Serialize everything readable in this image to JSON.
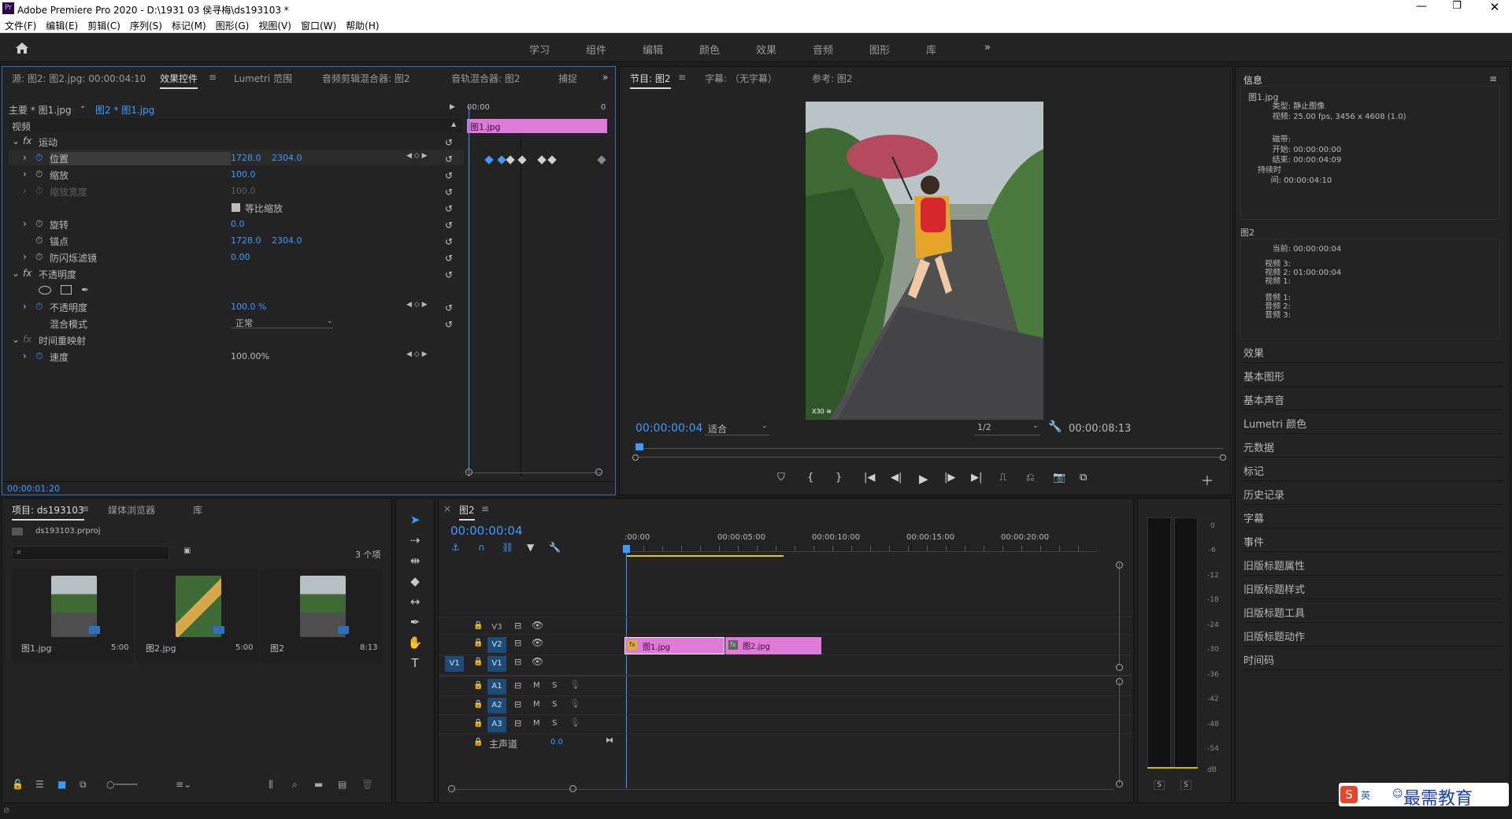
{
  "app": {
    "title": "Adobe Premiere Pro 2020 - D:\\1931 03 侯寻梅\\ds193103 *",
    "logo": "Pr"
  },
  "menu": [
    "文件(F)",
    "编辑(E)",
    "剪辑(C)",
    "序列(S)",
    "标记(M)",
    "图形(G)",
    "视图(V)",
    "窗口(W)",
    "帮助(H)"
  ],
  "workspaces": [
    "学习",
    "组件",
    "编辑",
    "颜色",
    "效果",
    "音频",
    "图形",
    "库"
  ],
  "source_panel": {
    "tabs": [
      "源: 图2: 图2.jpg: 00:00:04:10",
      "效果控件",
      "Lumetri 范围",
      "音频剪辑混合器: 图2",
      "音轨混合器: 图2",
      "捕捉"
    ],
    "master_label": "主要 * 图1.jpg",
    "clip_label": "图2 * 图1.jpg",
    "ruler_time": "00:00",
    "clip_name": "图1.jpg",
    "section_video": "视频",
    "properties": [
      {
        "label": "运动",
        "fx": "fx"
      },
      {
        "label": "位置",
        "v1": "1728.0",
        "v2": "2304.0"
      },
      {
        "label": "缩放",
        "v1": "100.0"
      },
      {
        "label": "缩放宽度",
        "v1": "100.0"
      },
      {
        "label": "等比缩放"
      },
      {
        "label": "旋转",
        "v1": "0.0"
      },
      {
        "label": "锚点",
        "v1": "1728.0",
        "v2": "2304.0"
      },
      {
        "label": "防闪烁滤镜",
        "v1": "0.00"
      },
      {
        "label": "不透明度",
        "fx": "fx"
      },
      {
        "label": "不透明度",
        "v1": "100.0 %"
      },
      {
        "label": "混合模式",
        "v1": "正常"
      },
      {
        "label": "时间重映射",
        "fx": "fx"
      },
      {
        "label": "速度",
        "v1": "100.00%"
      }
    ],
    "current_time": "00:00:01:20"
  },
  "program_panel": {
    "tabs": [
      "节目: 图2",
      "字幕: （无字幕）",
      "参考: 图2"
    ],
    "timecode": "00:00:00:04",
    "fit": "适合",
    "resolution": "1/2",
    "duration": "00:00:08:13",
    "watermark": "X30 ≋"
  },
  "info_panel": {
    "title": "信息",
    "clip": "图1.jpg",
    "lines1": [
      {
        "k": "类型:",
        "v": "静止图像"
      },
      {
        "k": "视频:",
        "v": "25.00 fps, 3456 x 4608 (1.0)"
      },
      {
        "k": "磁带:",
        "v": ""
      },
      {
        "k": "开始:",
        "v": "00:00:00:00"
      },
      {
        "k": "结束:",
        "v": "00:00:04:09"
      },
      {
        "k": "持续时间:",
        "v": "00:00:04:10"
      }
    ],
    "seq": "图2",
    "lines2": [
      {
        "k": "当前:",
        "v": "00:00:00:04"
      },
      {
        "k": "视频 3:",
        "v": ""
      },
      {
        "k": "视频 2:",
        "v": "01:00:00:04"
      },
      {
        "k": "视频 1:",
        "v": ""
      },
      {
        "k": "音频 1:",
        "v": ""
      },
      {
        "k": "音频 2:",
        "v": ""
      },
      {
        "k": "音频 3:",
        "v": ""
      }
    ]
  },
  "side_items": [
    "效果",
    "基本图形",
    "基本声音",
    "Lumetri 颜色",
    "元数据",
    "标记",
    "历史记录",
    "字幕",
    "事件",
    "旧版标题属性",
    "旧版标题样式",
    "旧版标题工具",
    "旧版标题动作",
    "时间码"
  ],
  "project_panel": {
    "tabs": [
      "项目: ds193103",
      "媒体浏览器",
      "库"
    ],
    "file": "ds193103.prproj",
    "count": "3 个项",
    "items": [
      {
        "name": "图1.jpg",
        "dur": "5:00"
      },
      {
        "name": "图2.jpg",
        "dur": "5:00"
      },
      {
        "name": "图2",
        "dur": "8:13"
      }
    ]
  },
  "timeline": {
    "tab": "图2",
    "timecode": "00:00:00:04",
    "ruler": [
      ":00:00",
      "00:00:05:00",
      "00:00:10:00",
      "00:00:15:00",
      "00:00:20:00"
    ],
    "video_tracks": [
      "V3",
      "V2",
      "V1"
    ],
    "audio_tracks": [
      "A1",
      "A2",
      "A3"
    ],
    "master": "主声道",
    "master_val": "0.0",
    "source_v": "V1",
    "clips": [
      {
        "name": "图1.jpg",
        "badge": "fx"
      },
      {
        "name": "图2.jpg",
        "badge": "fx"
      }
    ],
    "m": "M",
    "s": "S"
  },
  "meter": {
    "scale": [
      "0",
      "-6",
      "-12",
      "-18",
      "-24",
      "-30",
      "-36",
      "-42",
      "-48",
      "-54",
      "dB"
    ],
    "s": "S"
  },
  "brand": {
    "text": "最需教育",
    "ime": "英"
  }
}
